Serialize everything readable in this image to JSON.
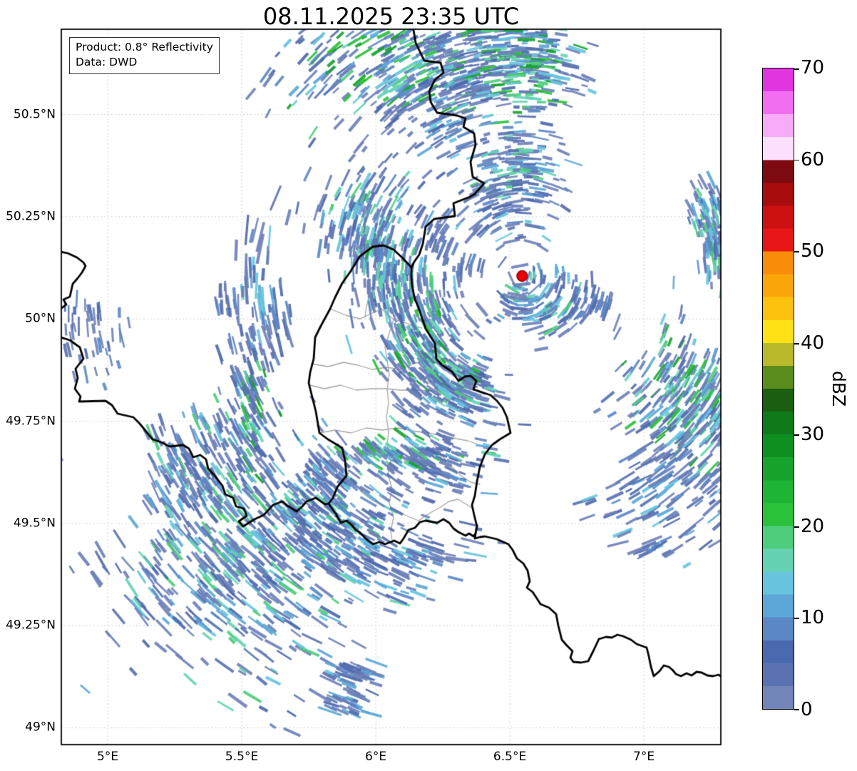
{
  "title": "08.11.2025 23:35 UTC",
  "info_box": {
    "line1": "Product: 0.8° Reflectivity",
    "line2": "Data: DWD"
  },
  "colorbar": {
    "label": "dBZ",
    "min": 0,
    "max": 70,
    "step": 2.5,
    "ticks": [
      {
        "value": 0,
        "label": "0"
      },
      {
        "value": 10,
        "label": "10"
      },
      {
        "value": 20,
        "label": "20"
      },
      {
        "value": 30,
        "label": "30"
      },
      {
        "value": 40,
        "label": "40"
      },
      {
        "value": 50,
        "label": "50"
      },
      {
        "value": 60,
        "label": "60"
      },
      {
        "value": 70,
        "label": "70"
      }
    ],
    "colors_bottom_to_top": [
      "#7384b8",
      "#5a72b1",
      "#4b69ae",
      "#5b88c5",
      "#5ca7d7",
      "#68c4de",
      "#66d2b4",
      "#4ecd7d",
      "#2bc13a",
      "#1eb534",
      "#16a42c",
      "#0e8f20",
      "#0e7a1a",
      "#1b5e10",
      "#5a8c1e",
      "#b9b92b",
      "#ffe115",
      "#fdc20e",
      "#fba70b",
      "#f98c09",
      "#e81616",
      "#cd1010",
      "#a80c0c",
      "#7d0a10",
      "#fcdffc",
      "#f8abf8",
      "#f16ef1",
      "#e135e1"
    ]
  },
  "map": {
    "extent": {
      "lon_min": 4.827,
      "lon_max": 7.287,
      "lat_min": 48.959,
      "lat_max": 50.7085
    },
    "gridline_lons": [
      5,
      5.5,
      6,
      6.5,
      7
    ],
    "gridline_lats": [
      49,
      49.25,
      49.5,
      49.75,
      50,
      50.25,
      50.5
    ],
    "x_ticks": [
      {
        "lon": 5,
        "label": "5°E"
      },
      {
        "lon": 5.5,
        "label": "5.5°E"
      },
      {
        "lon": 6,
        "label": "6°E"
      },
      {
        "lon": 6.5,
        "label": "6.5°E"
      },
      {
        "lon": 7,
        "label": "7°E"
      }
    ],
    "y_ticks": [
      {
        "lat": 49,
        "label": "49°N"
      },
      {
        "lat": 49.25,
        "label": "49.25°N"
      },
      {
        "lat": 49.5,
        "label": "49.5°N"
      },
      {
        "lat": 49.75,
        "label": "49.75°N"
      },
      {
        "lat": 50,
        "label": "50°N"
      },
      {
        "lat": 50.25,
        "label": "50.25°N"
      },
      {
        "lat": 50.5,
        "label": "50.5°N"
      }
    ],
    "radar_site": {
      "lon": 6.546,
      "lat": 50.105
    },
    "colors": {
      "grid": "#cfcfcf",
      "admin_border": "#a3a3a3",
      "country_border": "#000000",
      "frame": "#000000",
      "background": "#ffffff",
      "radar_dot": "#e8000b",
      "radar_dot_edge": "#8f0000"
    },
    "borders_px": {
      "country": [
        [
          580,
          42,
          583,
          60,
          595,
          85,
          618,
          88,
          622,
          102,
          610,
          112,
          602,
          128,
          604,
          143,
          613,
          158,
          641,
          162,
          653,
          166,
          650,
          178,
          665,
          187,
          667,
          203,
          660,
          227,
          663,
          248,
          679,
          257,
          666,
          272,
          659,
          276,
          636,
          285,
          638,
          303,
          609,
          307,
          597,
          318,
          593,
          342,
          588,
          357,
          581,
          367,
          577,
          375
        ],
        [
          577,
          375,
          565,
          362,
          552,
          350,
          538,
          344,
          523,
          346,
          516,
          351,
          505,
          359,
          492,
          380,
          480,
          397,
          470,
          417,
          463,
          433,
          450,
          457,
          442,
          473,
          440,
          503,
          435,
          522,
          433,
          537,
          438,
          557,
          443,
          577,
          448,
          607,
          460,
          616,
          480,
          628,
          484,
          646,
          486,
          667,
          473,
          683,
          467,
          698,
          461,
          706,
          472,
          722,
          478,
          733,
          486,
          730,
          493,
          736,
          499,
          743,
          504,
          746,
          515,
          757,
          523,
          763,
          532,
          760,
          540,
          763,
          553,
          758,
          561,
          762,
          566,
          755,
          573,
          743,
          582,
          740,
          589,
          732,
          597,
          730,
          613,
          733,
          622,
          728,
          630,
          733,
          636,
          741,
          643,
          746,
          653,
          751,
          658,
          748,
          664,
          752,
          667,
          748,
          669,
          738,
          665,
          722,
          662,
          708,
          666,
          695,
          669,
          675,
          673,
          655,
          680,
          637,
          690,
          624,
          701,
          616,
          716,
          607,
          711,
          585,
          705,
          572,
          697,
          562,
          688,
          554,
          676,
          550,
          664,
          546,
          668,
          534,
          660,
          527,
          652,
          528,
          643,
          534,
          634,
          521,
          620,
          512,
          612,
          503,
          610,
          481,
          597,
          461,
          592,
          446,
          587,
          431,
          582,
          420,
          578,
          401,
          577,
          388,
          577,
          375
        ],
        [
          85,
          473,
          98,
          477,
          112,
          487,
          117,
          503,
          106,
          517,
          109,
          530,
          105,
          545,
          113,
          556,
          111,
          563,
          148,
          562,
          157,
          568,
          165,
          580,
          187,
          585,
          196,
          594,
          214,
          616,
          226,
          620,
          238,
          626,
          257,
          624,
          265,
          629,
          271,
          641,
          281,
          638,
          289,
          644,
          292,
          657,
          302,
          668,
          312,
          681,
          316,
          693,
          327,
          698,
          331,
          710,
          342,
          713,
          346,
          723,
          335,
          731,
          341,
          738,
          357,
          728,
          370,
          722,
          383,
          708,
          396,
          703,
          403,
          709,
          416,
          717,
          424,
          710,
          430,
          703,
          443,
          698,
          450,
          703,
          456,
          707,
          461,
          706
        ],
        [
          85,
          353,
          95,
          355,
          108,
          361,
          117,
          368,
          120,
          373,
          115,
          382,
          109,
          390,
          102,
          398,
          98,
          416,
          89,
          420,
          93,
          427,
          85,
          433
        ],
        [
          667,
          748,
          666,
          755,
          673,
          753,
          680,
          752,
          697,
          756,
          713,
          763,
          719,
          771,
          725,
          783,
          734,
          790,
          740,
          800,
          743,
          815,
          739,
          824,
          747,
          830,
          753,
          839,
          758,
          847,
          770,
          852,
          780,
          861,
          783,
          877,
          788,
          897,
          795,
          905,
          803,
          913,
          800,
          922,
          804,
          928,
          815,
          929,
          825,
          927,
          833,
          911,
          840,
          896,
          850,
          893,
          858,
          894,
          866,
          890,
          874,
          892,
          885,
          897,
          893,
          903,
          907,
          908,
          910,
          920,
          913,
          935,
          917,
          948,
          925,
          941,
          931,
          933,
          938,
          935,
          943,
          939,
          948,
          945,
          955,
          948,
          963,
          944,
          970,
          947,
          977,
          942,
          984,
          943,
          992,
          947,
          1000,
          948,
          1008,
          946,
          1013,
          950
        ]
      ],
      "admin": [
        [
          463,
          433,
          485,
          442,
          505,
          447,
          520,
          440,
          535,
          433,
          552,
          448,
          570,
          453,
          585,
          458,
          592,
          460
        ],
        [
          437,
          510,
          460,
          514,
          482,
          508,
          502,
          512,
          522,
          518,
          543,
          515,
          560,
          518,
          580,
          510,
          598,
          505,
          610,
          502
        ],
        [
          552,
          448,
          545,
          470,
          540,
          487,
          543,
          505,
          546,
          525,
          543,
          545,
          545,
          565,
          542,
          585,
          545,
          605,
          543,
          625
        ],
        [
          435,
          540,
          455,
          545,
          478,
          540,
          500,
          547,
          520,
          545,
          543,
          545,
          562,
          547,
          585,
          547,
          605,
          548,
          625,
          548,
          640,
          543,
          647,
          540
        ],
        [
          448,
          607,
          470,
          603,
          492,
          607,
          514,
          600,
          536,
          603,
          558,
          600,
          578,
          604,
          598,
          607,
          618,
          610,
          640,
          615,
          656,
          618,
          668,
          622
        ],
        [
          543,
          625,
          548,
          645,
          544,
          665,
          550,
          685,
          546,
          705,
          552,
          725,
          548,
          745,
          550,
          757
        ],
        [
          505,
          688,
          520,
          700,
          538,
          710,
          556,
          716,
          572,
          724,
          587,
          730
        ],
        [
          587,
          730,
          602,
          720,
          616,
          712,
          630,
          703,
          642,
          700,
          654,
          707,
          663,
          713
        ],
        [
          598,
          607,
          610,
          625,
          622,
          641,
          634,
          655,
          648,
          668,
          660,
          676,
          673,
          679
        ],
        [
          516,
          351,
          515,
          380,
          520,
          405,
          514,
          430,
          512,
          445
        ]
      ]
    },
    "echoes": {
      "palette": [
        "#6d80b8",
        "#5a72b1",
        "#4e69ad",
        "#5b88c5",
        "#5ca7d7",
        "#68c4de",
        "#66d2b4",
        "#4ecd7d",
        "#2bc13a",
        "#16a42c"
      ],
      "cluster_fields": [
        "cx",
        "cy",
        "sx",
        "sy",
        "count",
        "intensity_tier",
        "length_scale"
      ],
      "clusters": [
        [
          558,
          92,
          78,
          46,
          380,
          4,
          1.0
        ],
        [
          726,
          86,
          46,
          40,
          280,
          4,
          1.0
        ],
        [
          635,
          160,
          34,
          38,
          70,
          2,
          1.0
        ],
        [
          723,
          242,
          36,
          30,
          150,
          3,
          1.0
        ],
        [
          700,
          300,
          24,
          26,
          50,
          2,
          1.0
        ],
        [
          620,
          335,
          14,
          20,
          28,
          1,
          1.2
        ],
        [
          652,
          372,
          14,
          10,
          14,
          1,
          1.0
        ],
        [
          997,
          303,
          15,
          24,
          80,
          3,
          1.0
        ],
        [
          1003,
          357,
          11,
          20,
          60,
          4,
          1.0
        ],
        [
          366,
          424,
          20,
          62,
          70,
          2,
          1.7
        ],
        [
          314,
          416,
          7,
          16,
          12,
          1,
          1.3
        ],
        [
          520,
          310,
          40,
          42,
          200,
          3,
          1.0
        ],
        [
          527,
          350,
          16,
          10,
          45,
          4,
          1.0
        ],
        [
          612,
          433,
          16,
          13,
          24,
          1,
          1.0
        ],
        [
          553,
          404,
          28,
          33,
          130,
          3,
          1.0
        ],
        [
          598,
          492,
          30,
          44,
          240,
          4,
          1.0
        ],
        [
          640,
          549,
          30,
          26,
          130,
          3,
          1.0
        ],
        [
          664,
          527,
          8,
          7,
          30,
          4,
          0.8
        ],
        [
          560,
          634,
          52,
          13,
          120,
          4,
          1.0
        ],
        [
          612,
          653,
          30,
          22,
          80,
          2,
          1.0
        ],
        [
          768,
          421,
          33,
          24,
          130,
          3,
          1.0
        ],
        [
          822,
          426,
          12,
          16,
          18,
          1,
          1.0
        ],
        [
          851,
          431,
          7,
          5,
          8,
          1,
          1.0
        ],
        [
          350,
          589,
          20,
          66,
          150,
          4,
          1.0
        ],
        [
          271,
          661,
          35,
          36,
          120,
          3,
          1.0
        ],
        [
          124,
          472,
          26,
          32,
          45,
          1,
          1.0
        ],
        [
          335,
          777,
          82,
          86,
          520,
          3,
          1.15
        ],
        [
          445,
          661,
          17,
          19,
          40,
          2,
          1.0
        ],
        [
          470,
          733,
          44,
          40,
          220,
          3,
          1.0
        ],
        [
          562,
          783,
          46,
          26,
          100,
          2,
          1.2
        ],
        [
          499,
          946,
          21,
          11,
          40,
          2,
          1.3
        ],
        [
          495,
          986,
          17,
          8,
          26,
          2,
          1.3
        ],
        [
          963,
          566,
          44,
          52,
          320,
          4,
          1.0
        ],
        [
          943,
          692,
          52,
          42,
          120,
          2,
          1.2
        ],
        [
          914,
          770,
          11,
          5,
          10,
          2,
          1.0
        ]
      ]
    }
  }
}
